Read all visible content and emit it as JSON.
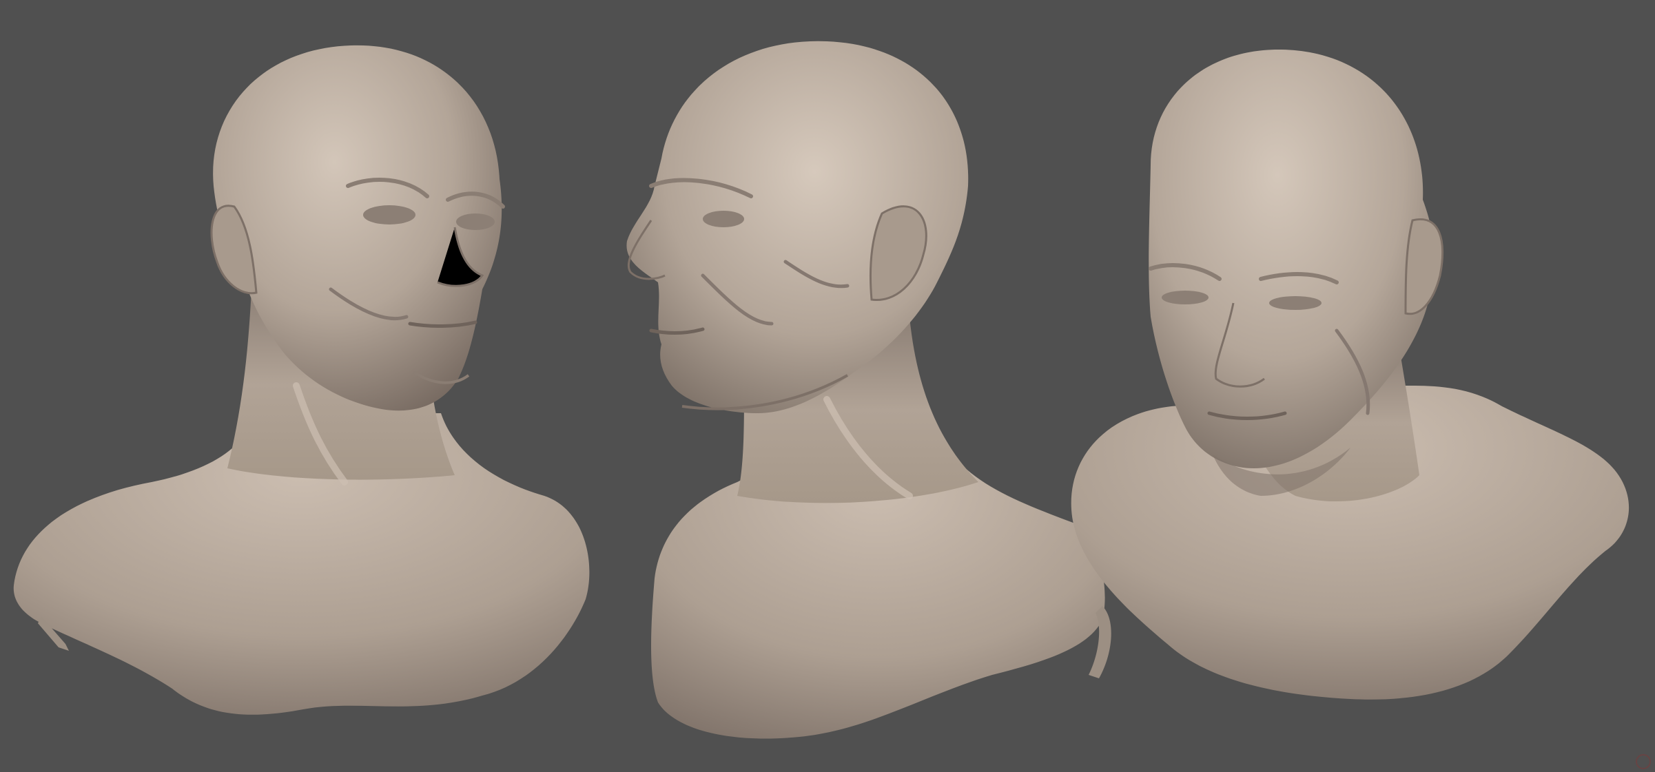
{
  "scene": {
    "background_color": "#505050",
    "material_base_color": "#b3a598",
    "material_highlight_color": "#d2c5b8",
    "material_shadow_color": "#6e625a",
    "views": [
      {
        "view": "three-quarter-right"
      },
      {
        "view": "profile-left"
      },
      {
        "view": "three-quarter-down-right"
      }
    ]
  }
}
